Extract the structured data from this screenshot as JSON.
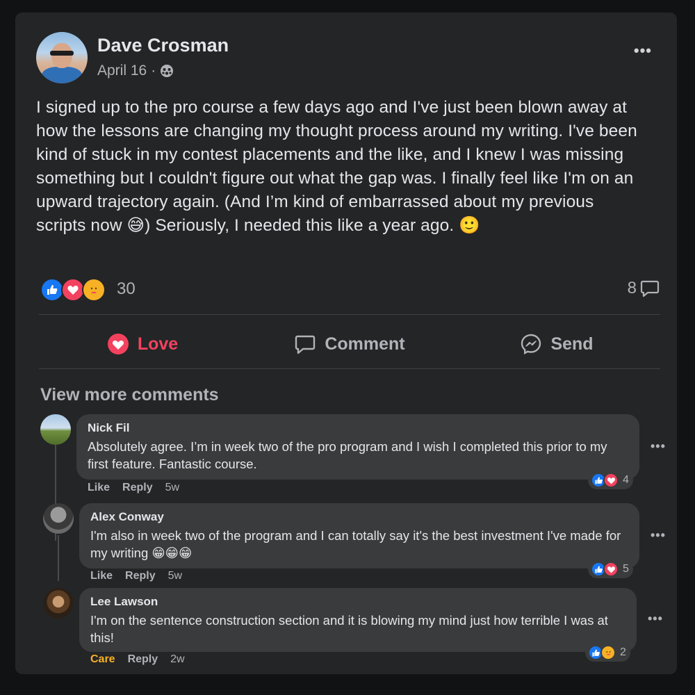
{
  "post": {
    "author": "Dave Crosman",
    "date": "April 16",
    "separator": "·",
    "privacy_icon": "friends-icon",
    "text": "I signed up to the pro course a few days ago and I've just been blown away at how the lessons are changing my thought process around my writing. I've been kind of stuck in my contest placements and the like, and I knew I was missing something but I couldn't figure out what the gap was. I finally feel like I'm on an upward trajectory again. (And I’m kind of embarrassed about my previous scripts now 😅) Seriously, I needed this like a year ago. 🙂",
    "more": "•••",
    "reaction_count": "30",
    "comment_count": "8",
    "reactions": [
      "like",
      "love",
      "care"
    ]
  },
  "actions": {
    "love": "Love",
    "comment": "Comment",
    "send": "Send"
  },
  "colors": {
    "love": "#f3425f",
    "like": "#1877f2",
    "care": "#f7b125"
  },
  "view_more": "View more comments",
  "comments": [
    {
      "name": "Nick Fil",
      "text": "Absolutely agree. I’m in week two of the pro program and I wish I completed this prior to my first feature. Fantastic course.",
      "action1": "Like",
      "reply": "Reply",
      "time": "5w",
      "reaction_count": "4",
      "more": "•••"
    },
    {
      "name": "Alex Conway",
      "text": "I'm also in week two of the program and I can totally say it's the best investment I've made for my writing 😁😁😁",
      "action1": "Like",
      "reply": "Reply",
      "time": "5w",
      "reaction_count": "5",
      "more": "•••"
    },
    {
      "name": "Lee Lawson",
      "text": "I'm on the sentence construction section and it is blowing my mind just how terrible I was at this!",
      "action1": "Care",
      "reply": "Reply",
      "time": "2w",
      "reaction_count": "2",
      "more": "•••"
    }
  ]
}
